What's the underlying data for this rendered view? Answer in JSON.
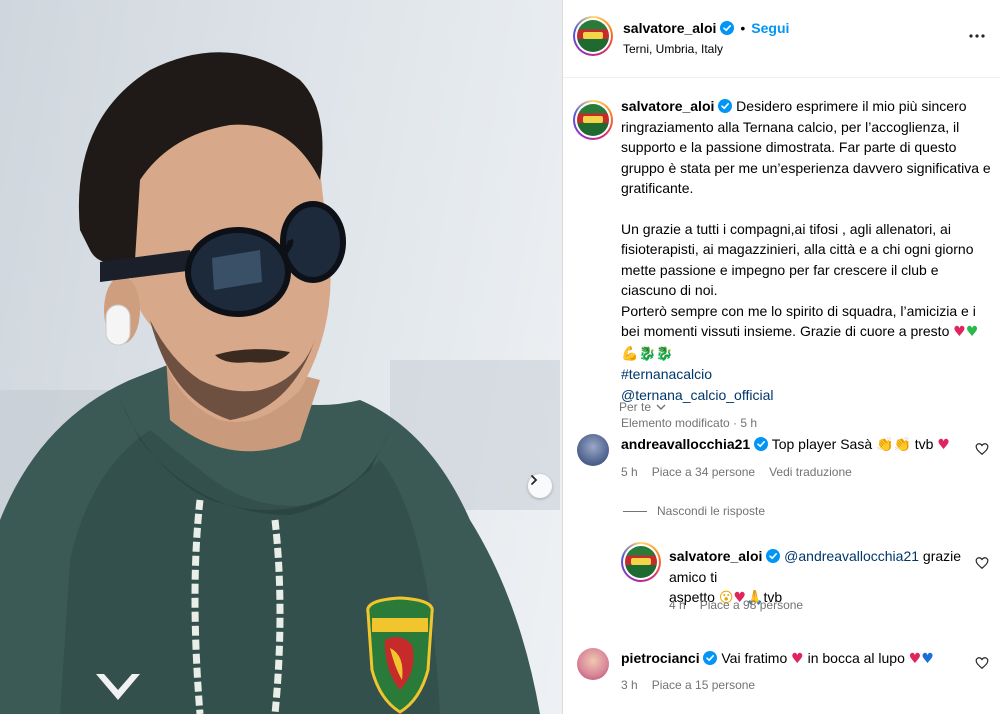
{
  "header": {
    "username": "salvatore_aloi",
    "separator": "•",
    "follow_label": "Segui",
    "location": "Terni, Umbria, Italy"
  },
  "caption": {
    "username": "salvatore_aloi",
    "para1": "Desidero esprimere il mio più sincero ringraziamento alla Ternana calcio, per l’accoglienza, il supporto e la passione dimostrata. Far parte di questo gruppo è stata per me un’esperienza davvero significativa e gratificante.",
    "para2a": "Un grazie a tutti i compagni,ai tifosi , agli allenatori, ai fisioterapisti, ai magazzinieri, alla città e a chi ogni giorno mette passione e impegno per far crescere il club e ciascuno di noi.",
    "para2b": "Porterò sempre con me lo spirito di squadra, l’amicizia e i bei momenti vissuti insieme. Grazie di cuore a presto",
    "emojis": "♥♥💪🐉🐉",
    "hashtag": "#ternanacalcio",
    "mention": "@ternana_calcio_official",
    "meta": "Elemento modificato · 5 h"
  },
  "translate_label": "Per te",
  "comments": [
    {
      "username": "andreavallocchia21",
      "text": "Top player Sasà",
      "tail": "tvb",
      "time": "5 h",
      "likes": "Piace a 34 persone",
      "translate": "Vedi traduzione"
    },
    {
      "username": "pietrocianci",
      "text": "Vai fratimo",
      "tail": "in bocca al lupo",
      "time": "3 h",
      "likes": "Piace a 15 persone"
    }
  ],
  "hide_replies_label": "Nascondi le risposte",
  "reply": {
    "username": "salvatore_aloi",
    "mention": "@andreavallocchia21",
    "text1": "grazie amico ti",
    "text2": "aspetto",
    "tail": "tvb",
    "time": "4 h",
    "likes": "Piace a 98 persone"
  },
  "crest_text": "TERNANA",
  "colors": {
    "link": "#00376b",
    "follow": "#0095f6",
    "muted": "#737373",
    "verified": "#0095f6"
  }
}
